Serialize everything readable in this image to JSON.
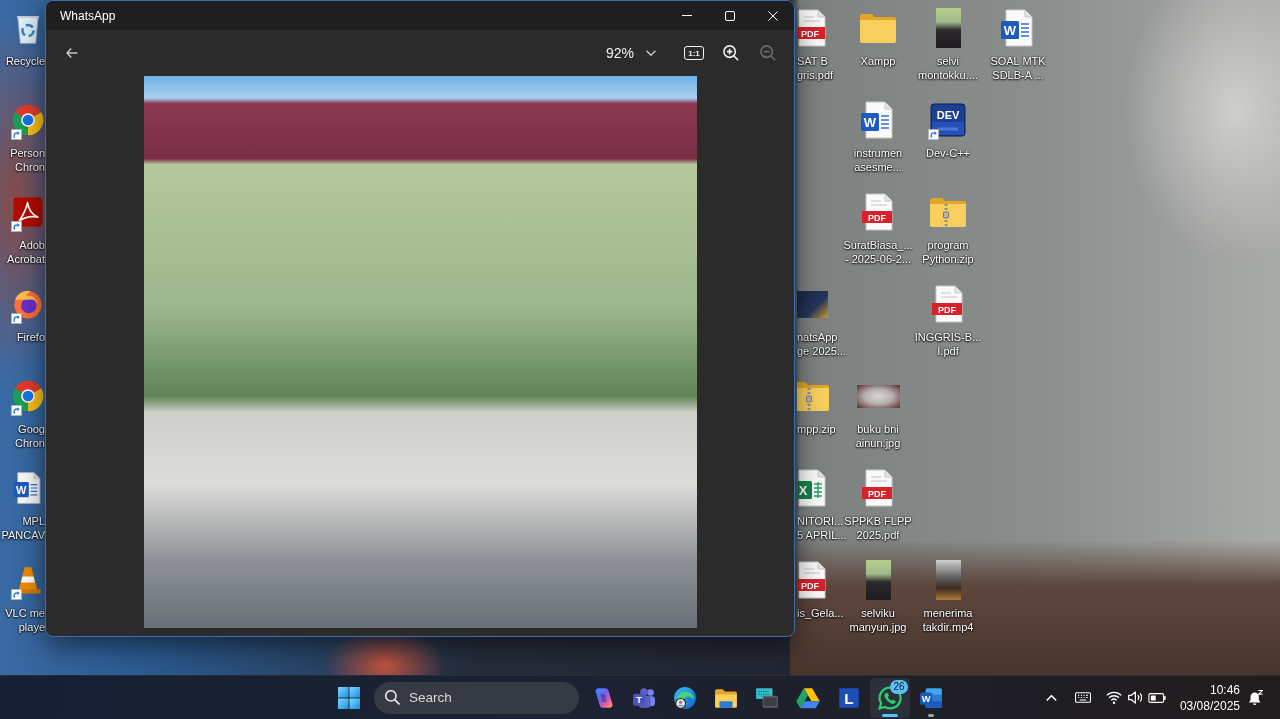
{
  "window": {
    "title": "WhatsApp",
    "zoom_level": "92%",
    "actual_size": "1:1",
    "zoom_in": {
      "disabled": false
    },
    "zoom_out": {
      "disabled": true
    }
  },
  "desktop": {
    "left_column": [
      {
        "label_lines": [
          "Recycle"
        ],
        "kind": "recycle_bin",
        "shortcut": false
      },
      {
        "label_lines": [
          "Person",
          "Chron"
        ],
        "kind": "chrome",
        "shortcut": true
      },
      {
        "label_lines": [
          "Adob",
          "Acrobat"
        ],
        "kind": "acrobat",
        "shortcut": true
      },
      {
        "label_lines": [
          "Firefo"
        ],
        "kind": "firefox",
        "shortcut": true
      },
      {
        "label_lines": [
          "Goog",
          "Chron"
        ],
        "kind": "chrome",
        "shortcut": true
      },
      {
        "label_lines": [
          "MPL",
          "PANCAV"
        ],
        "kind": "word",
        "icon_text": "W",
        "shortcut": false
      },
      {
        "label_lines": [
          "VLC me",
          "playe"
        ],
        "kind": "vlc",
        "shortcut": true
      }
    ],
    "right_area": [
      {
        "label_lines": [
          "SAT B",
          "gris.pdf"
        ],
        "kind": "pdf",
        "icon_text": "PDF",
        "shortcut": false
      },
      {
        "label_lines": [
          "Xampp"
        ],
        "kind": "folder",
        "shortcut": false
      },
      {
        "label_lines": [
          "selvi",
          "montokku...."
        ],
        "kind": "photo_tall",
        "shortcut": false
      },
      {
        "label_lines": [
          "SOAL MTK",
          "SDLB-A ..."
        ],
        "kind": "word",
        "icon_text": "W",
        "shortcut": false
      },
      {
        "label_lines": [
          "instrumen",
          "asesme..."
        ],
        "kind": "word",
        "icon_text": "W",
        "shortcut": false
      },
      {
        "label_lines": [
          "Dev-C++"
        ],
        "kind": "dev",
        "icon_text": "DEV",
        "shortcut": true
      },
      {
        "label_lines": [
          "SuratBiasa_...",
          "- 2025-06-2..."
        ],
        "kind": "pdf",
        "icon_text": "PDF",
        "shortcut": false
      },
      {
        "label_lines": [
          "program",
          "Python.zip"
        ],
        "kind": "zip",
        "shortcut": false
      },
      {
        "label_lines": [
          "natsApp",
          "ge 2025..."
        ],
        "kind": "photo_square",
        "shortcut": false
      },
      {
        "label_lines": [
          "INGGRIS-B...",
          "I.pdf"
        ],
        "kind": "pdf",
        "icon_text": "PDF",
        "shortcut": false
      },
      {
        "label_lines": [
          "mpp.zip"
        ],
        "kind": "zip",
        "shortcut": false
      },
      {
        "label_lines": [
          "buku bni",
          "ainun.jpg"
        ],
        "kind": "photo_wide",
        "shortcut": false
      },
      {
        "label_lines": [
          "NITORI...",
          "5 APRIL..."
        ],
        "kind": "excel",
        "icon_text": "X",
        "shortcut": false
      },
      {
        "label_lines": [
          "SPPKB FLPP",
          "2025.pdf"
        ],
        "kind": "pdf",
        "icon_text": "PDF",
        "shortcut": false
      },
      {
        "label_lines": [
          "is_Gela..."
        ],
        "kind": "pdf",
        "icon_text": "PDF",
        "shortcut": false
      },
      {
        "label_lines": [
          "selviku",
          "manyun.jpg"
        ],
        "kind": "photo_tall",
        "shortcut": false
      },
      {
        "label_lines": [
          "menerima",
          "takdir.mp4"
        ],
        "kind": "video_tall",
        "shortcut": false
      }
    ]
  },
  "taskbar": {
    "search": {
      "placeholder": "Search"
    },
    "apps": [
      {
        "kind": "copilot",
        "open": false,
        "selected": false
      },
      {
        "kind": "teams",
        "icon_text": "T",
        "open": false,
        "selected": false
      },
      {
        "kind": "edge",
        "open": false,
        "selected": false
      },
      {
        "kind": "explorer",
        "open": false,
        "selected": false
      },
      {
        "kind": "remote",
        "open": false,
        "selected": false
      },
      {
        "kind": "drive",
        "open": false,
        "selected": false
      },
      {
        "kind": "lapp",
        "icon_text": "L",
        "open": false,
        "selected": false
      },
      {
        "kind": "whatsapp",
        "badge": "26",
        "open": true,
        "selected": true
      },
      {
        "kind": "word",
        "icon_text": "W",
        "open": true,
        "selected": false
      }
    ],
    "clock": {
      "time": "10:46",
      "date": "03/08/2025"
    }
  }
}
